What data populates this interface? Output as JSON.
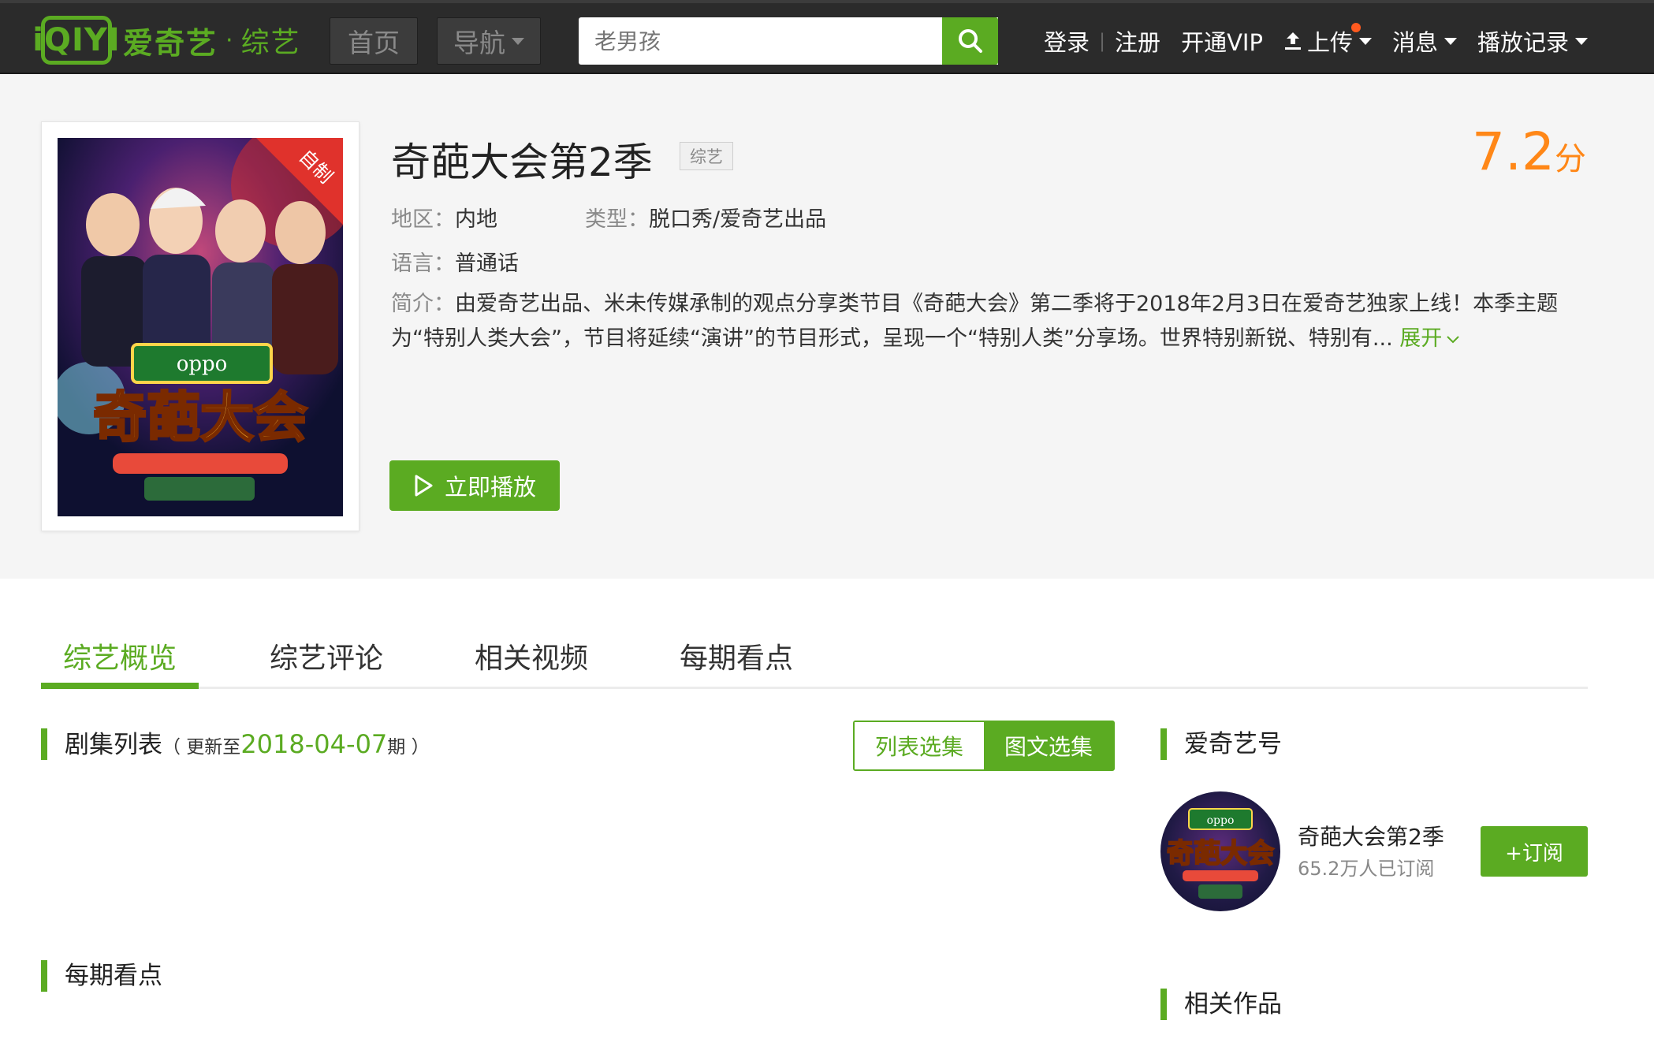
{
  "colors": {
    "brand": "#5bab22",
    "score": "#ff8717",
    "topbar": "#2b2b2b"
  },
  "header": {
    "logo_mark": "iQIYI",
    "logo_text": "爱奇艺",
    "logo_dot": "·",
    "channel": "综艺",
    "nav_home": "首页",
    "nav_guide": "导航",
    "search_placeholder": "老男孩",
    "links": {
      "login": "登录",
      "separator": "|",
      "register": "注册",
      "vip": "开通VIP",
      "upload": "上传",
      "messages": "消息",
      "history": "播放记录"
    }
  },
  "show": {
    "title": "奇葩大会第2季",
    "genre_tag": "综艺",
    "score": "7.2",
    "score_unit": "分",
    "region_label": "地区：",
    "region": "内地",
    "type_label": "类型：",
    "type": "脱口秀/爱奇艺出品",
    "language_label": "语言：",
    "language": "普通话",
    "desc_label": "简介：",
    "desc": "由爱奇艺出品、米未传媒承制的观点分享类节目《奇葩大会》第二季将于2018年2月3日在爱奇艺独家上线！本季主题为“特别人类大会”，节目将延续“演讲”的节目形式，呈现一个“特别人类”分享场。世界特别新锐、特别有...",
    "expand": "展开",
    "play_label": "立即播放",
    "poster": {
      "badge": "自制",
      "sponsor": "oppo",
      "logo": "奇葩大会"
    }
  },
  "tabs": [
    {
      "label": "综艺概览"
    },
    {
      "label": "综艺评论"
    },
    {
      "label": "相关视频"
    },
    {
      "label": "每期看点"
    }
  ],
  "episodes": {
    "title": "剧集列表",
    "update_prefix": "（ 更新至",
    "update_date": "2018-04-07",
    "update_suffix": "期 ）",
    "view_list": "列表选集",
    "view_image": "图文选集"
  },
  "highlights": {
    "title": "每期看点"
  },
  "iqiyihao": {
    "title": "爱奇艺号",
    "channel_name": "奇葩大会第2季",
    "subscribers": "65.2万人已订阅",
    "subscribe_label": "+订阅"
  },
  "related": {
    "title": "相关作品"
  }
}
